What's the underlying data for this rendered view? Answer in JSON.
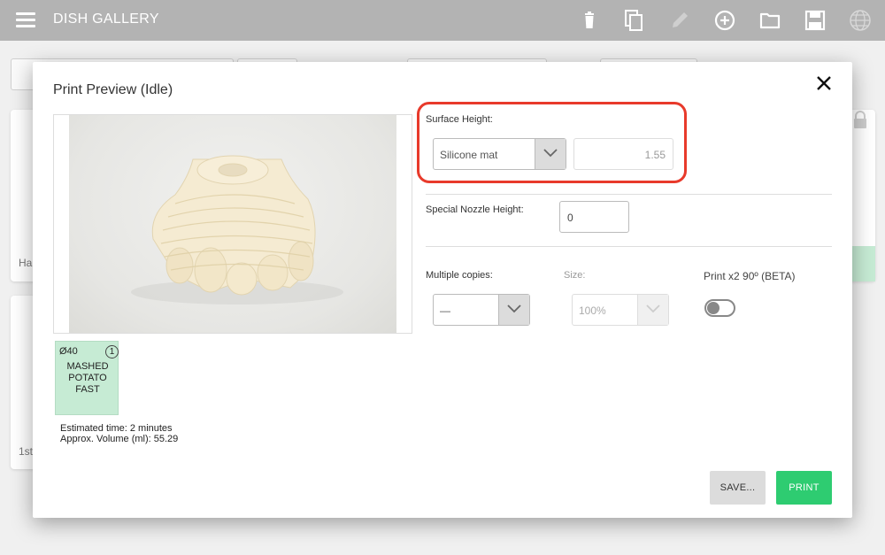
{
  "app": {
    "title": "DISH GALLERY"
  },
  "toolbar": {
    "icons": [
      "menu-icon",
      "trash-icon",
      "copy-icon",
      "pencil-icon",
      "add-circle-icon",
      "folder-icon",
      "save-icon",
      "globe-icon"
    ]
  },
  "background": {
    "card1_text": "Ha",
    "card2_text": "1st"
  },
  "dialog": {
    "title": "Print Preview (Idle)",
    "dish": {
      "size": "Ø40",
      "count": "1",
      "name_lines": [
        "MASHED",
        "POTATO",
        "FAST"
      ],
      "tile_color": "#c6ebd4"
    },
    "estimated_time": "Estimated time: 2 minutes",
    "approx_volume": "Approx. Volume (ml): 55.29",
    "surface_height": {
      "label": "Surface Height:",
      "selected": "Silicone mat",
      "value": "1.55"
    },
    "special_nozzle": {
      "label": "Special Nozzle Height:",
      "value": "0"
    },
    "multiple_copies": {
      "label": "Multiple copies:",
      "selected": "—"
    },
    "size": {
      "label": "Size:",
      "selected": "100%"
    },
    "print_x2": {
      "label": "Print x2 90º (BETA)",
      "enabled": false
    },
    "buttons": {
      "save": "SAVE...",
      "print": "PRINT"
    },
    "colors": {
      "highlight": "#e83a2b",
      "print_button": "#2ecc71"
    }
  }
}
